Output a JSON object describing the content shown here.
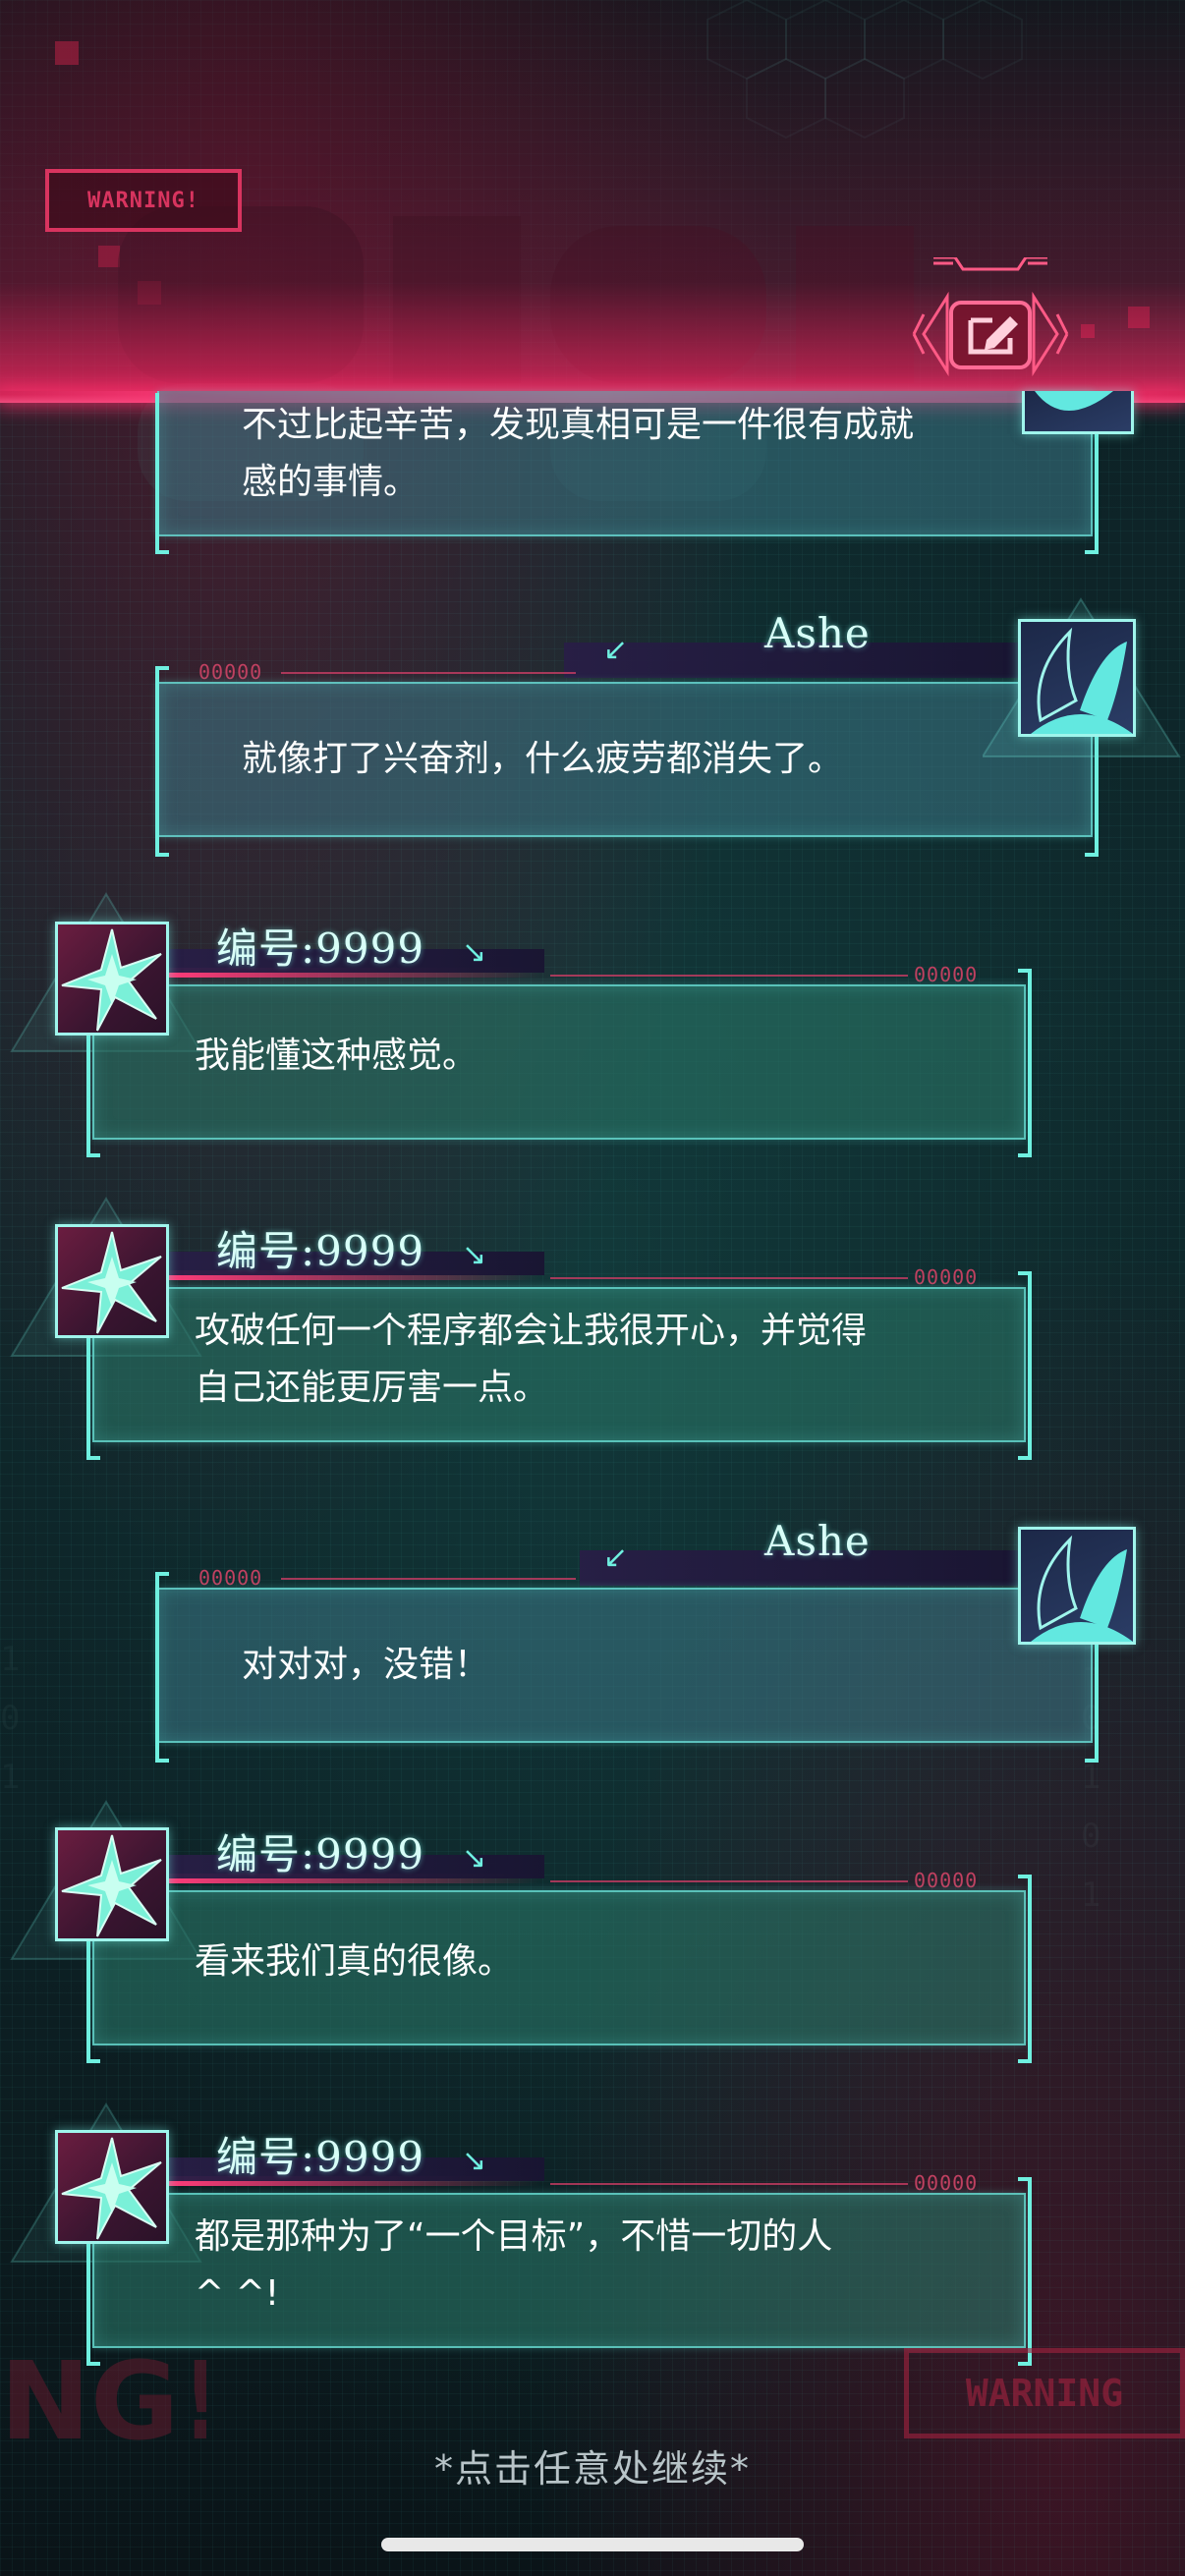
{
  "header": {
    "warning_label": "WARNING!",
    "edit_button_icon": "edit-pencil-icon"
  },
  "messages": [
    {
      "speaker": "Ashe",
      "side": "right",
      "show_name": false,
      "serial": "",
      "text": "不过比起辛苦，发现真相可是一件很有成就\n感的事情。"
    },
    {
      "speaker": "Ashe",
      "side": "right",
      "show_name": true,
      "serial": "00000",
      "text": "就像打了兴奋剂，什么疲劳都消失了。"
    },
    {
      "speaker": "编号:9999",
      "side": "left",
      "show_name": true,
      "serial": "00000",
      "text": "我能懂这种感觉。"
    },
    {
      "speaker": "编号:9999",
      "side": "left",
      "show_name": true,
      "serial": "00000",
      "text": "攻破任何一个程序都会让我很开心，并觉得\n自己还能更厉害一点。"
    },
    {
      "speaker": "Ashe",
      "side": "right",
      "show_name": true,
      "serial": "00000",
      "text": "对对对，没错！"
    },
    {
      "speaker": "编号:9999",
      "side": "left",
      "show_name": true,
      "serial": "00000",
      "text": "看来我们真的很像。"
    },
    {
      "speaker": "编号:9999",
      "side": "left",
      "show_name": true,
      "serial": "00000",
      "text": "都是那种为了“一个目标”，不惜一切的人\n^ ^!"
    }
  ],
  "footer": {
    "continue_hint": "*点击任意处继续*",
    "bottom_warning": "WARNING",
    "bottom_fragment": "NG!"
  },
  "colors": {
    "accent_cyan": "#6ff0e0",
    "warning_red": "#ff3c7a",
    "ashe_box": "#3c7887",
    "npc_box": "#28735f"
  }
}
